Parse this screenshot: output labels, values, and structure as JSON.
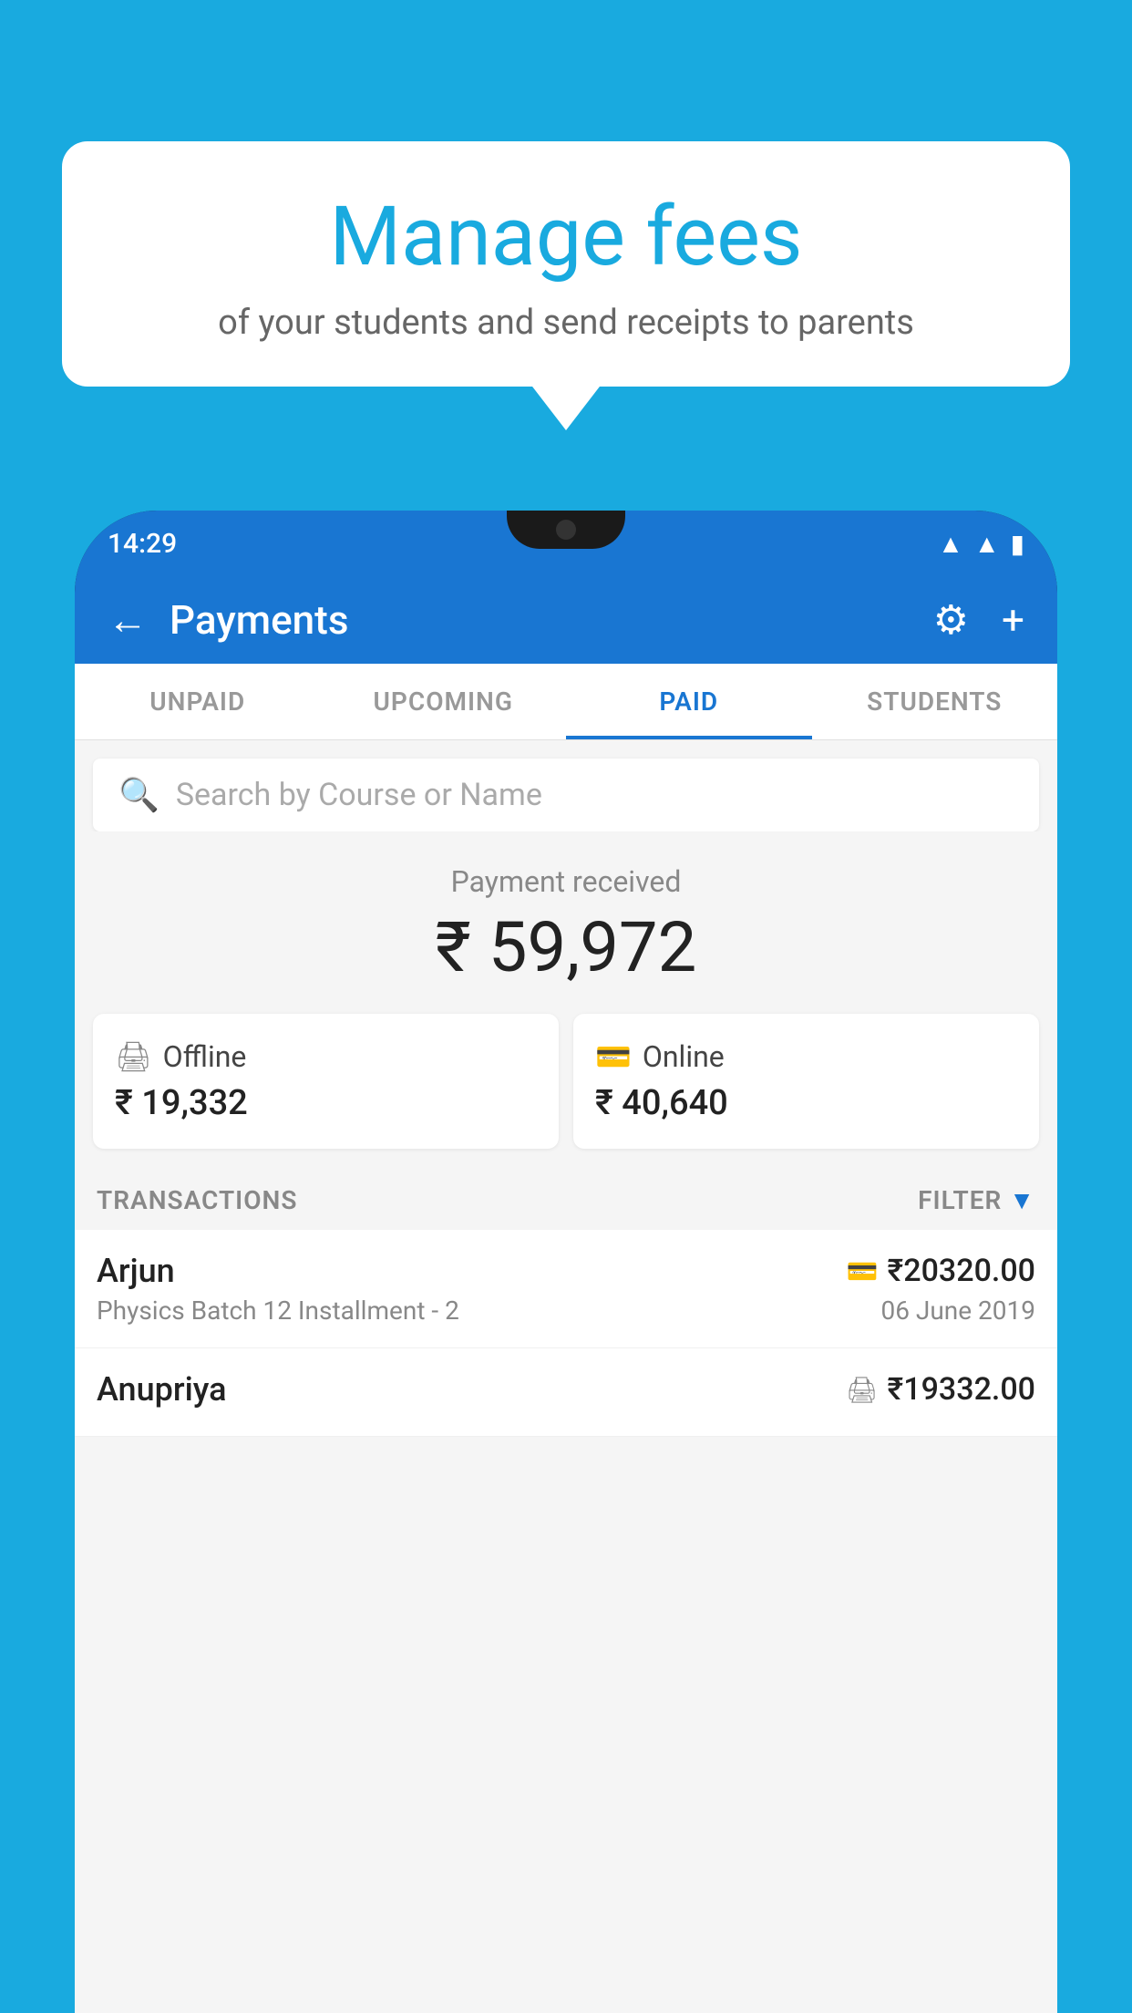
{
  "background_color": "#19AADF",
  "bubble": {
    "title": "Manage fees",
    "subtitle": "of your students and send receipts to parents"
  },
  "status_bar": {
    "time": "14:29",
    "wifi_icon": "▲",
    "signal_icon": "▲",
    "battery_icon": "▮"
  },
  "header": {
    "back_label": "←",
    "title": "Payments",
    "settings_icon": "⚙",
    "add_icon": "+"
  },
  "tabs": [
    {
      "label": "UNPAID",
      "active": false
    },
    {
      "label": "UPCOMING",
      "active": false
    },
    {
      "label": "PAID",
      "active": true
    },
    {
      "label": "STUDENTS",
      "active": false
    }
  ],
  "search": {
    "placeholder": "Search by Course or Name"
  },
  "payment_received": {
    "label": "Payment received",
    "amount": "₹ 59,972"
  },
  "payment_cards": [
    {
      "type": "Offline",
      "amount": "₹ 19,332",
      "icon": "💳"
    },
    {
      "type": "Online",
      "amount": "₹ 40,640",
      "icon": "💳"
    }
  ],
  "transactions": {
    "header_label": "TRANSACTIONS",
    "filter_label": "FILTER",
    "filter_icon": "▼",
    "rows": [
      {
        "name": "Arjun",
        "pay_type": "online",
        "amount": "₹20320.00",
        "course": "Physics Batch 12 Installment - 2",
        "date": "06 June 2019"
      },
      {
        "name": "Anupriya",
        "pay_type": "offline",
        "amount": "₹19332.00",
        "course": "",
        "date": ""
      }
    ]
  }
}
